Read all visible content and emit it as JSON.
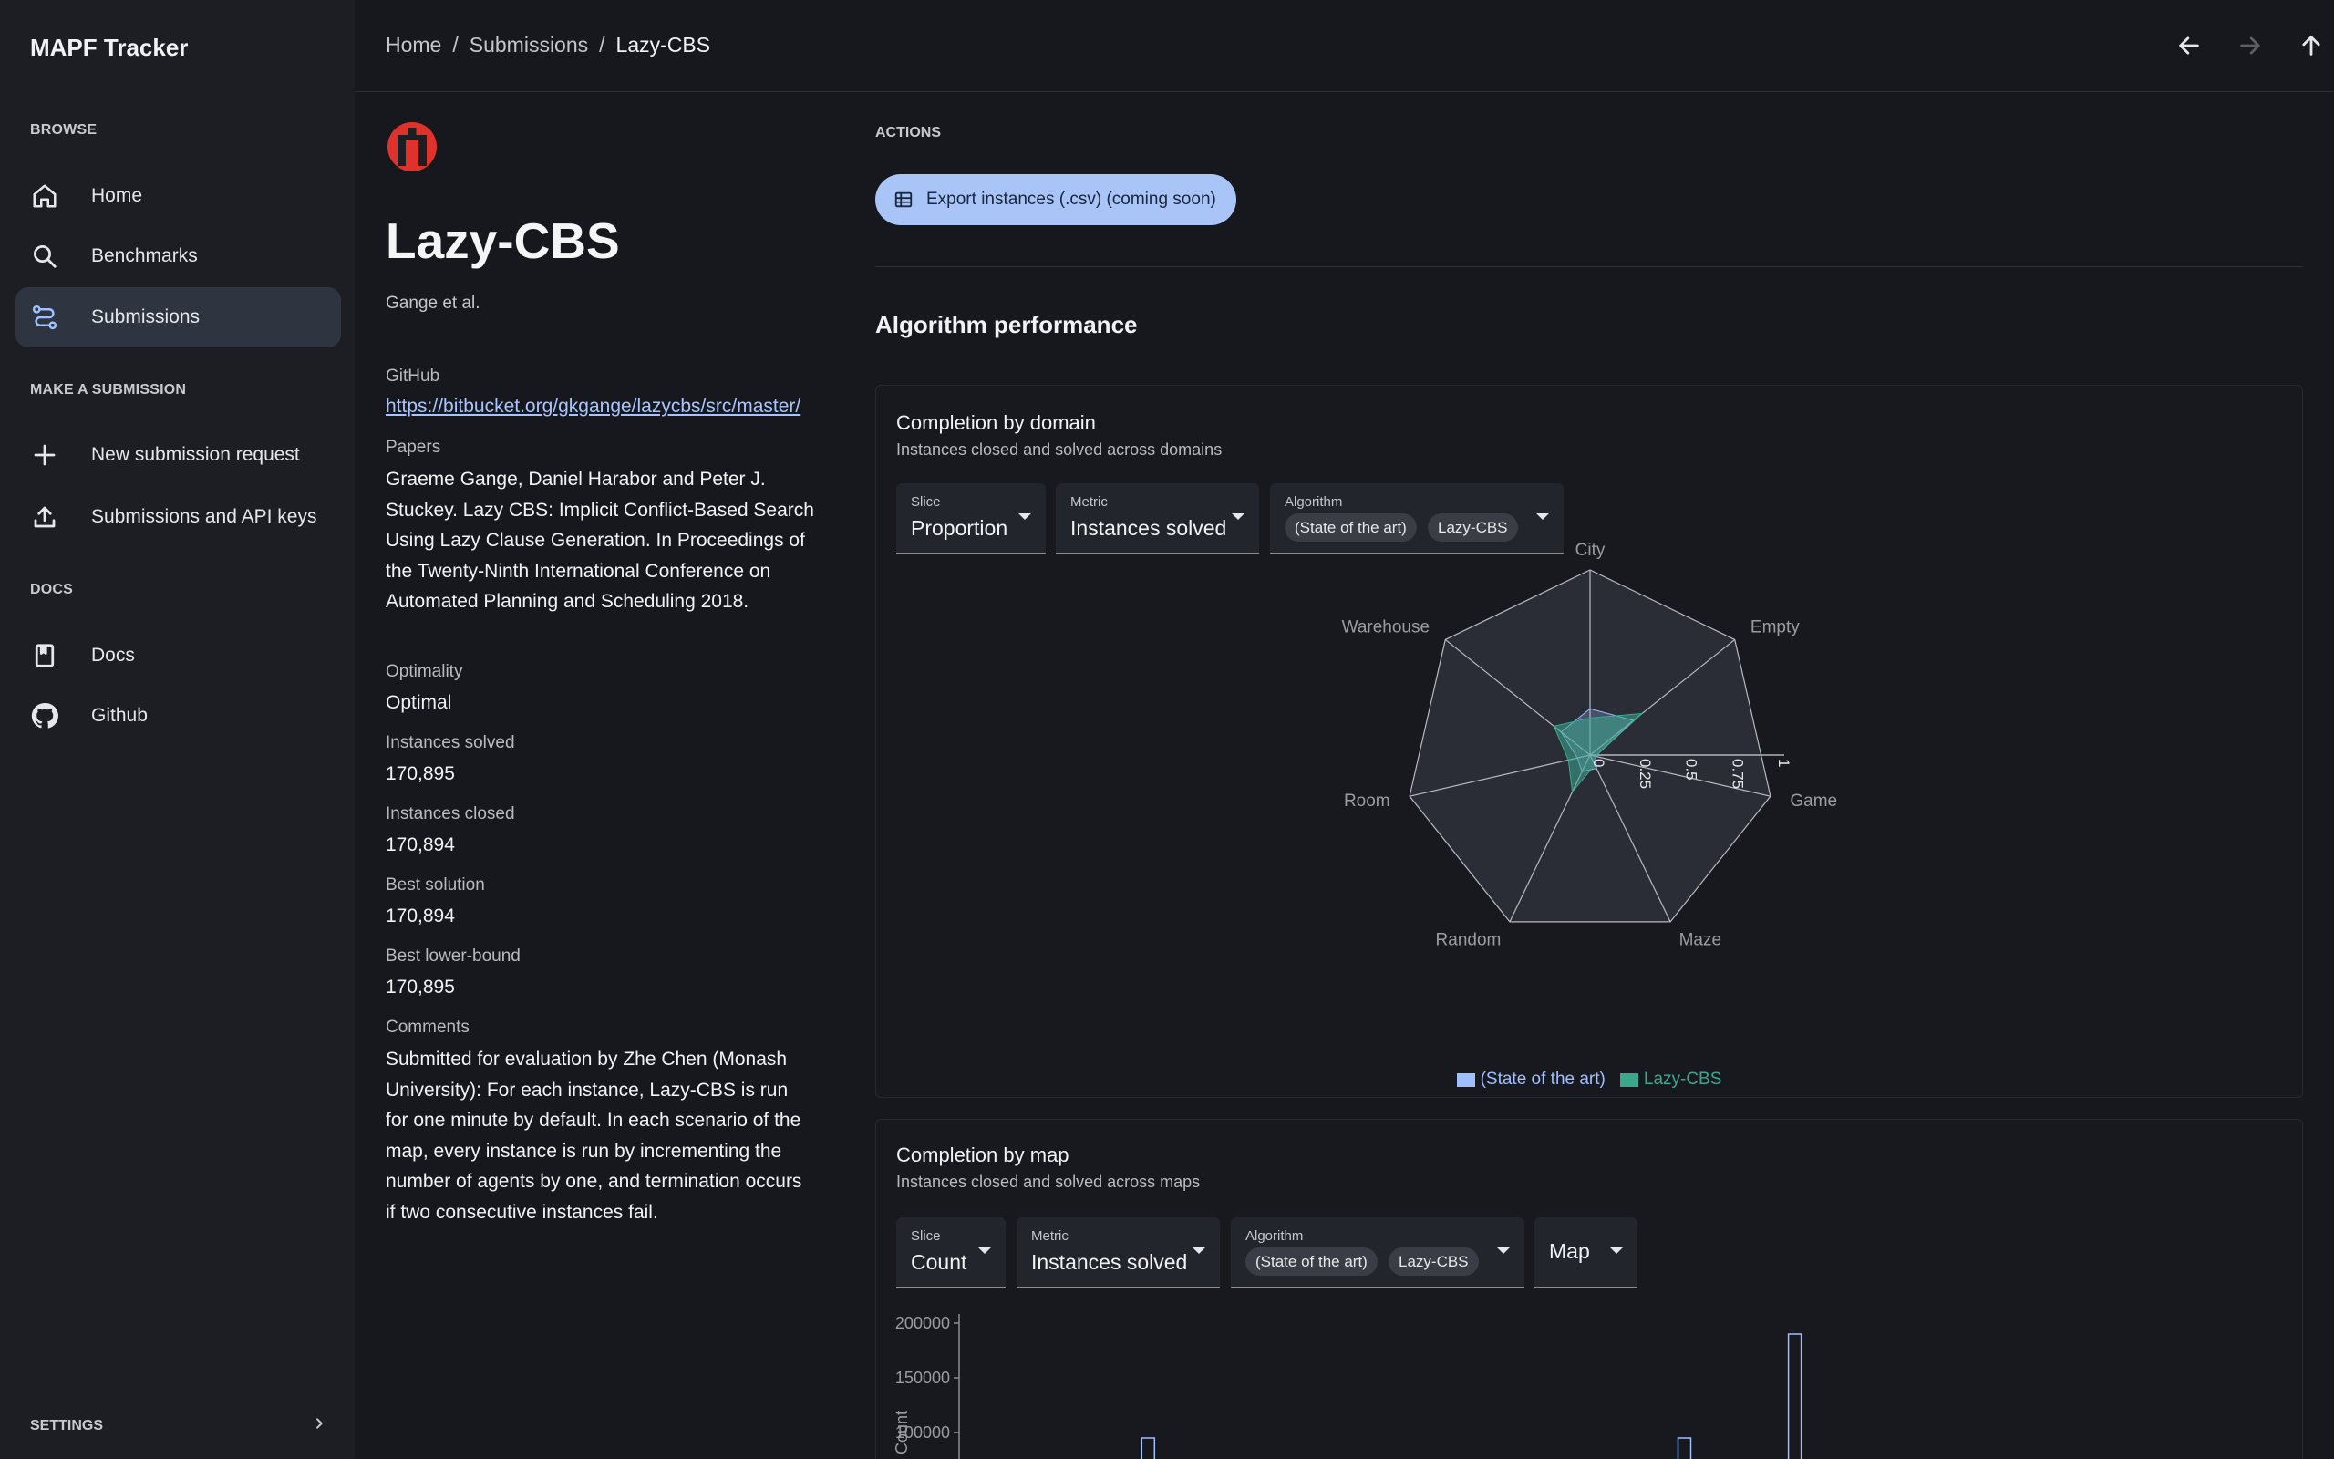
{
  "app": {
    "title": "MAPF Tracker"
  },
  "sidebar": {
    "sections": [
      {
        "label": "BROWSE"
      },
      {
        "label": "MAKE A SUBMISSION"
      },
      {
        "label": "DOCS"
      }
    ],
    "items": [
      {
        "label": "Home",
        "icon": "home-icon"
      },
      {
        "label": "Benchmarks",
        "icon": "search-icon"
      },
      {
        "label": "Submissions",
        "icon": "route-icon",
        "active": true
      },
      {
        "label": "New submission request",
        "icon": "plus-icon"
      },
      {
        "label": "Submissions and API keys",
        "icon": "upload-icon"
      },
      {
        "label": "Docs",
        "icon": "book-icon"
      },
      {
        "label": "Github",
        "icon": "github-icon"
      }
    ],
    "settings_label": "SETTINGS"
  },
  "header": {
    "breadcrumb": [
      "Home",
      "Submissions",
      "Lazy-CBS"
    ],
    "separator": "/"
  },
  "submission": {
    "name": "Lazy-CBS",
    "authors": "Gange et al.",
    "github_label": "GitHub",
    "github_url": "https://bitbucket.org/gkgange/lazycbs/src/master/",
    "papers_label": "Papers",
    "papers": "Graeme Gange, Daniel Harabor and Peter J. Stuckey. Lazy CBS: Implicit Conflict-Based Search Using Lazy Clause Generation. In Proceedings of the Twenty-Ninth International Conference on Automated Planning and Scheduling 2018.",
    "optimality_label": "Optimality",
    "optimality": "Optimal",
    "solved_label": "Instances solved",
    "solved": "170,895",
    "closed_label": "Instances closed",
    "closed": "170,894",
    "best_solution_label": "Best solution",
    "best_solution": "170,894",
    "best_lb_label": "Best lower-bound",
    "best_lb": "170,895",
    "comments_label": "Comments",
    "comments": "Submitted for evaluation by Zhe Chen (Monash University): For each instance, Lazy-CBS is run for one minute by default. In each scenario of the map, every instance is run by incrementing the number of agents by one, and termination occurs if two consecutive instances fail."
  },
  "actions": {
    "label": "ACTIONS",
    "export_label": "Export instances (.csv) (coming soon)"
  },
  "performance": {
    "title": "Algorithm performance",
    "domain_card": {
      "title": "Completion by domain",
      "subtitle": "Instances closed and solved across domains",
      "slice_label": "Slice",
      "slice_value": "Proportion",
      "metric_label": "Metric",
      "metric_value": "Instances solved",
      "algorithm_label": "Algorithm",
      "chips": [
        "(State of the art)",
        "Lazy-CBS"
      ]
    },
    "map_card": {
      "title": "Completion by map",
      "subtitle": "Instances closed and solved across maps",
      "slice_label": "Slice",
      "slice_value": "Count",
      "metric_label": "Metric",
      "metric_value": "Instances solved",
      "algorithm_label": "Algorithm",
      "chips": [
        "(State of the art)",
        "Lazy-CBS"
      ],
      "map_value": "Map"
    }
  },
  "colors": {
    "sota": "#9fbfff",
    "lazy": "#3aa88f",
    "accent_button": "#a9c5f8",
    "logo_red": "#e0322b"
  },
  "chart_data": [
    {
      "type": "radar",
      "categories": [
        "City",
        "Empty",
        "Game",
        "Maze",
        "Random",
        "Room",
        "Warehouse"
      ],
      "ticks": [
        "0",
        "0.25",
        "0.5",
        "0.75",
        "1"
      ],
      "range": [
        0,
        1
      ],
      "series": [
        {
          "name": "(State of the art)",
          "values": [
            0.25,
            0.3,
            0.03,
            0.08,
            0.1,
            0.07,
            0.2
          ]
        },
        {
          "name": "Lazy-CBS",
          "values": [
            0.2,
            0.36,
            0.03,
            0.06,
            0.22,
            0.12,
            0.25
          ]
        }
      ],
      "legend": "bottom"
    },
    {
      "type": "bar",
      "ylabel": "Count",
      "y_ticks": [
        200000,
        150000,
        100000
      ],
      "visible_bars": [
        {
          "index": 11,
          "value": 95000
        },
        {
          "index": 45,
          "value": 95000
        },
        {
          "index": 52,
          "value": 190000
        }
      ]
    }
  ]
}
